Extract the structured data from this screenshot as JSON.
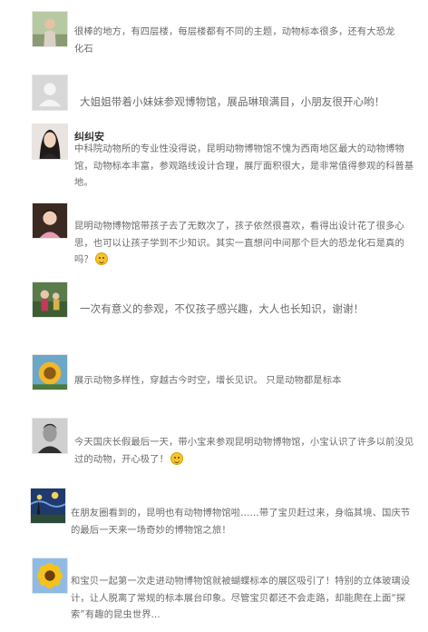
{
  "reviews": [
    {
      "text": "很棒的地方，有四层楼，每层楼都有不同的主题，动物标本很多，还有大恐龙化石",
      "avatar": "child-portrait-avatar"
    },
    {
      "text": "大姐姐带着小妹妹参观博物馆，展品琳琅满目，小朋友很开心哟！",
      "avatar": "default-user-avatar"
    },
    {
      "name": "纠纠安",
      "text": "中科院动物所的专业性没得说，昆明动物博物馆不愧为西南地区最大的动物博物馆，动物标本丰富，参观路线设计合理，展厅面积很大，是非常值得参观的科普基地。",
      "avatar": "woman-portrait-avatar"
    },
    {
      "text": "昆明动物博物馆带孩子去了无数次了，孩子依然很喜欢，看得出设计花了很多心思，也可以让孩子学到不少知识。其实一直想问中间那个巨大的恐龙化石是真的吗？",
      "avatar": "girl-portrait-avatar",
      "emoji": "grin-emoji"
    },
    {
      "text": "一次有意义的参观，不仅孩子感兴趣，大人也长知识，谢谢！",
      "avatar": "family-photo-avatar"
    },
    {
      "text": "展示动物多样性，穿越古今时空，增长见识。 只是动物都是标本",
      "avatar": "sunflower-painting-avatar"
    },
    {
      "text": "今天国庆长假最后一天，带小宝来参观昆明动物博物馆，小宝认识了许多以前没见过的动物，开心极了！",
      "avatar": "man-bw-portrait-avatar",
      "emoji": "smile-emoji"
    },
    {
      "text": "在朋友圈看到的，昆明也有动物博物馆啦……带了宝贝赶过来，身临其境、国庆节的最后一天来一场奇妙的博物馆之旅！",
      "avatar": "starry-night-avatar"
    },
    {
      "text": "和宝贝一起第一次走进动物博物馆就被蝴蝶标本的展区吸引了！特别的立体玻璃设计，让人脱离了常规的标本展台印象。尽管宝贝都还不会走路，却能爬在上面“探索”有趣的昆虫世界...",
      "avatar": "sunflower-avatar"
    }
  ]
}
